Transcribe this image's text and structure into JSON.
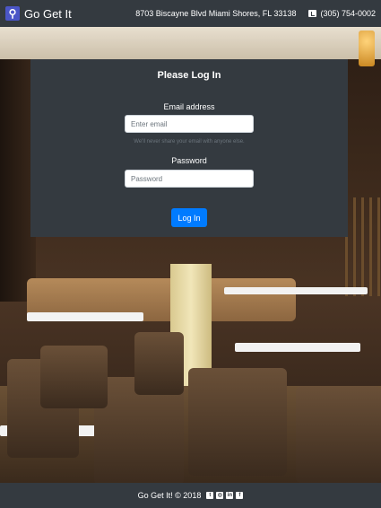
{
  "navbar": {
    "brand": "Go Get It",
    "address": "8703 Biscayne Blvd Miami Shores, FL 33138",
    "phone": "(305) 754-0002"
  },
  "login": {
    "title": "Please Log In",
    "email_label": "Email address",
    "email_placeholder": "Enter email",
    "email_value": "",
    "email_help": "We'll never share your email with anyone else.",
    "password_label": "Password",
    "password_placeholder": "Password",
    "password_value": "",
    "submit_label": "Log In"
  },
  "footer": {
    "text": "Go Get It! © 2018",
    "social": [
      {
        "icon": "twitter-icon",
        "glyph": "t"
      },
      {
        "icon": "instagram-icon",
        "glyph": "◎"
      },
      {
        "icon": "linkedin-icon",
        "glyph": "in"
      },
      {
        "icon": "facebook-icon",
        "glyph": "f"
      }
    ]
  },
  "colors": {
    "navbar_bg": "#343a40",
    "card_bg": "#343a40",
    "primary_button": "#007bff",
    "brand_logo": "#4b56c7"
  }
}
